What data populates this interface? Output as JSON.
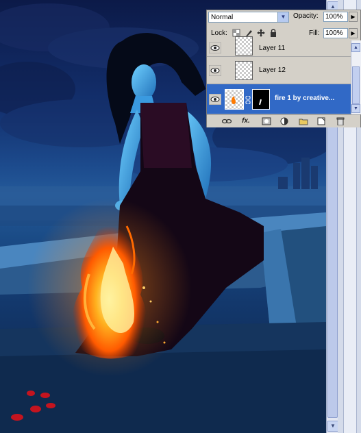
{
  "layers_panel": {
    "blend_mode": "Normal",
    "opacity_label": "Opacity:",
    "opacity_value": "100%",
    "lock_label": "Lock:",
    "fill_label": "Fill:",
    "fill_value": "100%",
    "layers": [
      {
        "name": "Layer 11",
        "visible": true,
        "selected": false
      },
      {
        "name": "Layer 12",
        "visible": true,
        "selected": false
      },
      {
        "name": "fire 1 by creative...",
        "visible": true,
        "selected": true,
        "has_mask": true
      }
    ],
    "footer_icons": [
      "link-icon",
      "fx-icon",
      "mask-icon",
      "adjustment-icon",
      "group-icon",
      "new-layer-icon",
      "trash-icon"
    ],
    "fx_label": "fx."
  },
  "colors": {
    "selection": "#3169c6",
    "panel_bg": "#d4d0c8",
    "canvas_sky": "#13306e",
    "fire": "#ff8a1a"
  }
}
